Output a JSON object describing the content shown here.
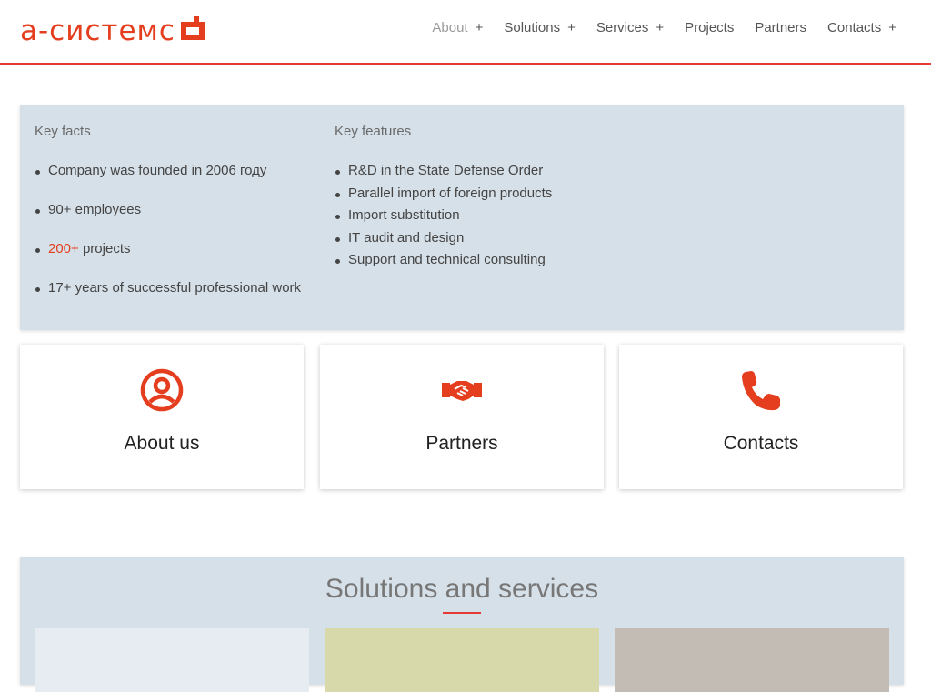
{
  "brand": {
    "logo_text": "а-системс",
    "accent_color": "#e53e1f"
  },
  "nav": {
    "items": [
      {
        "label": "About",
        "has_submenu": true,
        "active": true
      },
      {
        "label": "Solutions",
        "has_submenu": true
      },
      {
        "label": "Services",
        "has_submenu": true
      },
      {
        "label": "Projects",
        "has_submenu": false
      },
      {
        "label": "Partners",
        "has_submenu": false
      },
      {
        "label": "Contacts",
        "has_submenu": true
      }
    ],
    "plus_symbol": "+"
  },
  "facts": {
    "key_facts_title": "Key facts",
    "key_facts": [
      "Company was founded in 2006 году",
      "90+ employees",
      "projects",
      "17+ years of successful professional work"
    ],
    "projects_count": "200+",
    "key_features_title": "Key features",
    "key_features": [
      "R&D in the State Defense Order",
      "Parallel import of foreign products",
      "Import substitution",
      "IT audit and design",
      "Support and technical consulting"
    ]
  },
  "cards": [
    {
      "label": "About us",
      "icon": "user-circle-icon"
    },
    {
      "label": "Partners",
      "icon": "handshake-icon"
    },
    {
      "label": "Contacts",
      "icon": "phone-icon"
    }
  ],
  "solutions": {
    "title": "Solutions and services",
    "tile_colors": [
      "#e7ebf2",
      "#d8d9aa",
      "#c2bcb5"
    ]
  }
}
